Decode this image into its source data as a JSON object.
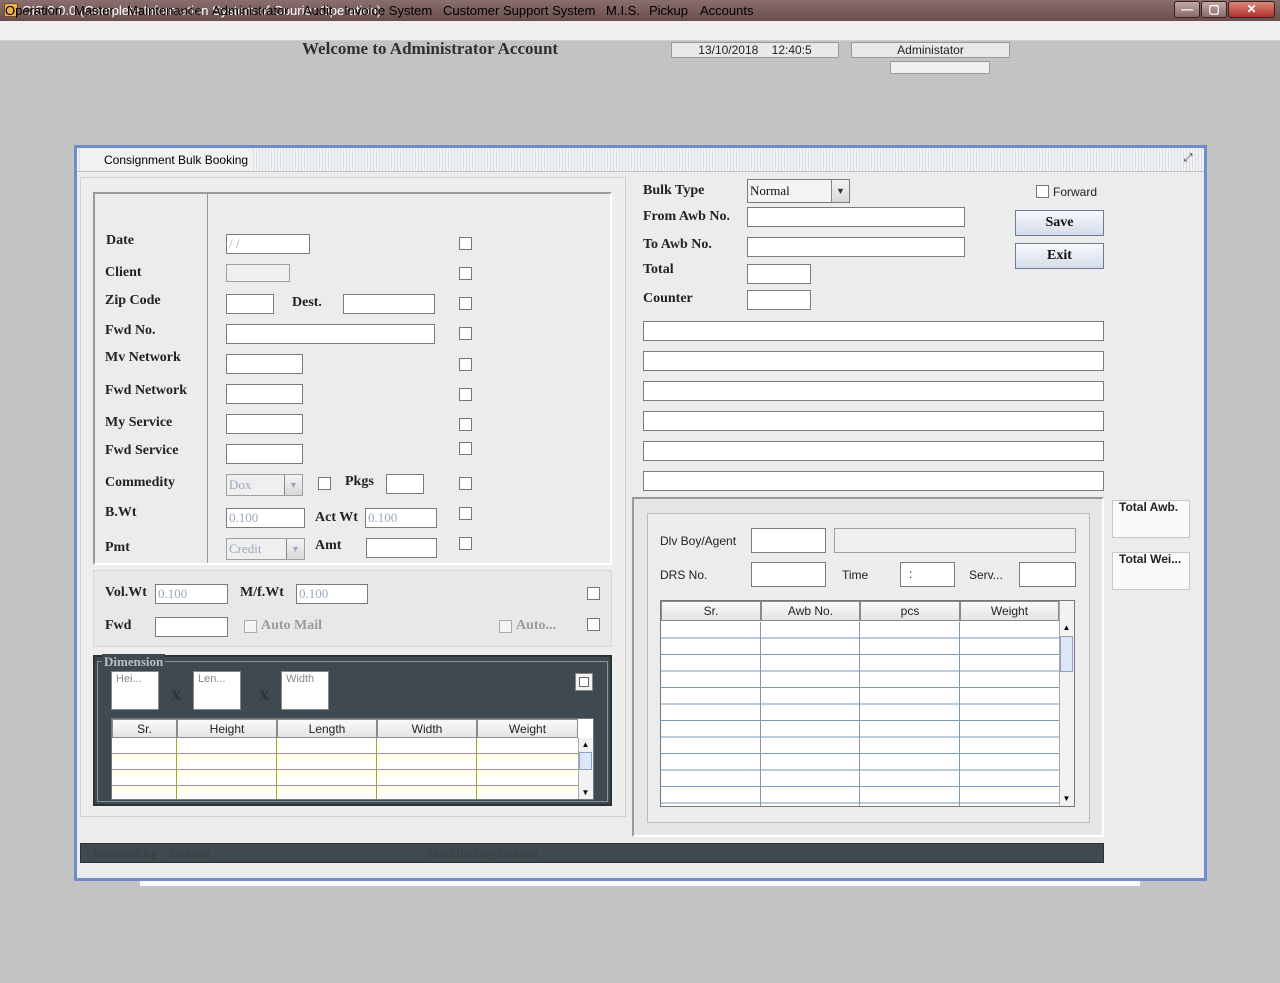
{
  "window": {
    "title": "CIS 8.0.0 (Complete Information System of Courier Operation)",
    "minimize": "—",
    "maximize": "▢",
    "close": "✕"
  },
  "menu": [
    "Operation",
    "Master",
    "Maintenance",
    "Administrator",
    "Audit",
    "Invoice System",
    "Customer Support System",
    "M.I.S.",
    "Pickup",
    "Accounts"
  ],
  "header": {
    "welcome": "Welcome to Administrator Account",
    "date": "13/10/2018",
    "time": "12:40:5",
    "user": "Administator"
  },
  "frame": {
    "title": "Consignment Bulk Booking",
    "maximize_glyph": "⤢"
  },
  "left": {
    "date_label": "Date",
    "date_value": "/  /",
    "client_label": "Client",
    "zip_label": "Zip Code",
    "dest_label": "Dest.",
    "fwd_no_label": "Fwd No.",
    "my_network_label": "Mv Network",
    "fwd_network_label": "Fwd Network",
    "my_service_label": "My Service",
    "fwd_service_label": "Fwd Service",
    "commodity_label": "Commedity",
    "commodity_value": "Dox",
    "pkgs_label": "Pkgs",
    "bwt_label": "B.Wt",
    "bwt_value": "0.100",
    "act_wt_label": "Act Wt",
    "act_wt_value": "0.100",
    "pmt_label": "Pmt",
    "pmt_value": "Credit",
    "amt_label": "Amt"
  },
  "weights": {
    "vol_label": "Vol.Wt",
    "vol_value": "0.100",
    "mf_label": "M/f.Wt",
    "mf_value": "0.100",
    "fwd_label": "Fwd",
    "auto_mail": "Auto Mail",
    "auto": "Auto..."
  },
  "dimension": {
    "title": "Dimension",
    "inputs": [
      "Hei...",
      "Len...",
      "Width"
    ],
    "x": "X",
    "columns": [
      "Sr.",
      "Height",
      "Length",
      "Width",
      "Weight"
    ]
  },
  "right": {
    "bulk_type_label": "Bulk Type",
    "bulk_type_value": "Normal",
    "forward_label": "Forward",
    "from_awb_label": "From Awb No.",
    "to_awb_label": "To Awb No.",
    "total_label": "Total",
    "counter_label": "Counter",
    "save": "Save",
    "exit": "Exit"
  },
  "delivery": {
    "dlv_boy_label": "Dlv Boy/Agent",
    "drs_label": "DRS No.",
    "time_label": "Time",
    "time_value": ":",
    "serv_label": "Serv...",
    "columns": [
      "Sr.",
      "Awb No.",
      "pcs",
      "Weight"
    ]
  },
  "totals": {
    "total_awb": "Total Awb.",
    "total_weight": "Total Wei..."
  },
  "status": {
    "inserted_label": "Inserted by",
    "inserted_value": "Default",
    "modified_label": "Modified by",
    "modified_value": "Default"
  }
}
